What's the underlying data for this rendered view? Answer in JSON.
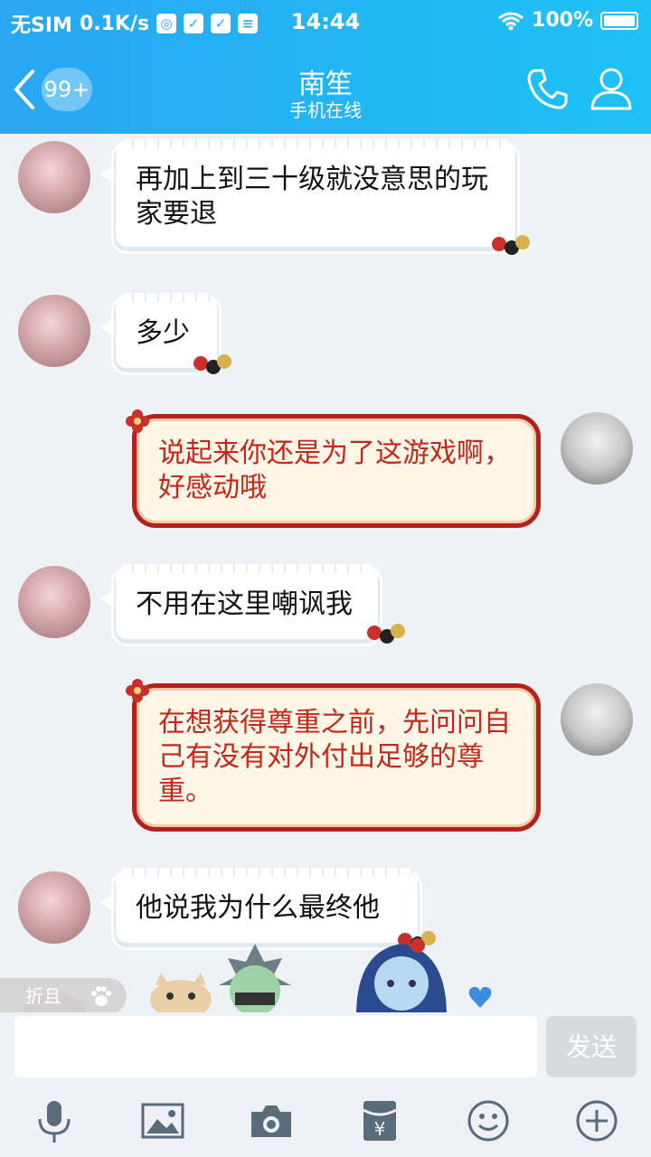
{
  "status_bar": {
    "carrier": "无SIM",
    "speed": "0.1K/s",
    "time": "14:44",
    "battery": "100%"
  },
  "header": {
    "unread_badge": "99+",
    "title": "南笙",
    "subtitle": "手机在线"
  },
  "messages": [
    {
      "side": "in",
      "text": "再加上到三十级就没意思的玩家要退"
    },
    {
      "side": "in",
      "text": "多少"
    },
    {
      "side": "out",
      "text": "说起来你还是为了这游戏啊，好感动哦"
    },
    {
      "side": "in",
      "text": "不用在这里嘲讽我"
    },
    {
      "side": "out",
      "text": "在想获得尊重之前，先问问自己有没有对外付出足够的尊重。"
    },
    {
      "side": "in",
      "text": "他说我为什么最终他"
    }
  ],
  "fold_label": "折且",
  "input": {
    "placeholder": "",
    "send_label": "发送"
  },
  "toolbar": {
    "icons": [
      "mic-icon",
      "image-icon",
      "camera-icon",
      "red-packet-icon",
      "emoji-icon",
      "plus-icon"
    ]
  },
  "colors": {
    "header_start": "#2aa6f2",
    "header_end": "#1ec2f7",
    "out_border": "#b3211d",
    "out_text": "#c1281b",
    "tool_icon": "#5a6b7a"
  }
}
